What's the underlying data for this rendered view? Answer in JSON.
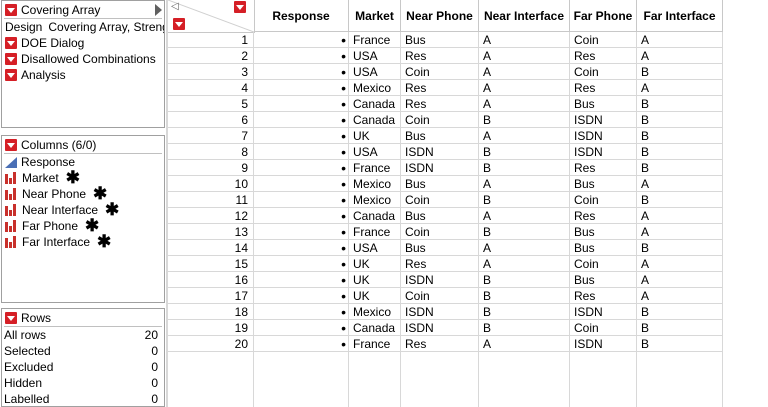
{
  "table_panel": {
    "title": "Covering Array",
    "design_label": "Design",
    "design_value": "Covering Array, Streng",
    "scripts": [
      "DOE Dialog",
      "Disallowed Combinations",
      "Analysis"
    ]
  },
  "columns_panel": {
    "title": "Columns (6/0)",
    "items": [
      {
        "name": "Response",
        "type": "continuous",
        "locked": false
      },
      {
        "name": "Market",
        "type": "nominal",
        "locked": true
      },
      {
        "name": "Near Phone",
        "type": "nominal",
        "locked": true
      },
      {
        "name": "Near Interface",
        "type": "nominal",
        "locked": true
      },
      {
        "name": "Far Phone",
        "type": "nominal",
        "locked": true
      },
      {
        "name": "Far Interface",
        "type": "nominal",
        "locked": true
      }
    ],
    "lock_symbol": "✱"
  },
  "rows_panel": {
    "title": "Rows",
    "stats": [
      {
        "label": "All rows",
        "value": "20"
      },
      {
        "label": "Selected",
        "value": "0"
      },
      {
        "label": "Excluded",
        "value": "0"
      },
      {
        "label": "Hidden",
        "value": "0"
      },
      {
        "label": "Labelled",
        "value": "0"
      }
    ]
  },
  "grid": {
    "columns": [
      "Response",
      "Market",
      "Near Phone",
      "Near Interface",
      "Far Phone",
      "Far Interface"
    ],
    "missing_symbol": "•",
    "rows": [
      {
        "n": "1",
        "market": "France",
        "near_phone": "Bus",
        "near_interface": "A",
        "far_phone": "Coin",
        "far_interface": "A"
      },
      {
        "n": "2",
        "market": "USA",
        "near_phone": "Res",
        "near_interface": "A",
        "far_phone": "Res",
        "far_interface": "A"
      },
      {
        "n": "3",
        "market": "USA",
        "near_phone": "Coin",
        "near_interface": "A",
        "far_phone": "Coin",
        "far_interface": "B"
      },
      {
        "n": "4",
        "market": "Mexico",
        "near_phone": "Res",
        "near_interface": "A",
        "far_phone": "Res",
        "far_interface": "A"
      },
      {
        "n": "5",
        "market": "Canada",
        "near_phone": "Res",
        "near_interface": "A",
        "far_phone": "Bus",
        "far_interface": "B"
      },
      {
        "n": "6",
        "market": "Canada",
        "near_phone": "Coin",
        "near_interface": "B",
        "far_phone": "ISDN",
        "far_interface": "B"
      },
      {
        "n": "7",
        "market": "UK",
        "near_phone": "Bus",
        "near_interface": "A",
        "far_phone": "ISDN",
        "far_interface": "B"
      },
      {
        "n": "8",
        "market": "USA",
        "near_phone": "ISDN",
        "near_interface": "B",
        "far_phone": "ISDN",
        "far_interface": "B"
      },
      {
        "n": "9",
        "market": "France",
        "near_phone": "ISDN",
        "near_interface": "B",
        "far_phone": "Res",
        "far_interface": "B"
      },
      {
        "n": "10",
        "market": "Mexico",
        "near_phone": "Bus",
        "near_interface": "A",
        "far_phone": "Bus",
        "far_interface": "A"
      },
      {
        "n": "11",
        "market": "Mexico",
        "near_phone": "Coin",
        "near_interface": "B",
        "far_phone": "Coin",
        "far_interface": "B"
      },
      {
        "n": "12",
        "market": "Canada",
        "near_phone": "Bus",
        "near_interface": "A",
        "far_phone": "Res",
        "far_interface": "A"
      },
      {
        "n": "13",
        "market": "France",
        "near_phone": "Coin",
        "near_interface": "B",
        "far_phone": "Bus",
        "far_interface": "A"
      },
      {
        "n": "14",
        "market": "USA",
        "near_phone": "Bus",
        "near_interface": "A",
        "far_phone": "Bus",
        "far_interface": "B"
      },
      {
        "n": "15",
        "market": "UK",
        "near_phone": "Res",
        "near_interface": "A",
        "far_phone": "Coin",
        "far_interface": "A"
      },
      {
        "n": "16",
        "market": "UK",
        "near_phone": "ISDN",
        "near_interface": "B",
        "far_phone": "Bus",
        "far_interface": "A"
      },
      {
        "n": "17",
        "market": "UK",
        "near_phone": "Coin",
        "near_interface": "B",
        "far_phone": "Res",
        "far_interface": "A"
      },
      {
        "n": "18",
        "market": "Mexico",
        "near_phone": "ISDN",
        "near_interface": "B",
        "far_phone": "ISDN",
        "far_interface": "B"
      },
      {
        "n": "19",
        "market": "Canada",
        "near_phone": "ISDN",
        "near_interface": "B",
        "far_phone": "Coin",
        "far_interface": "B"
      },
      {
        "n": "20",
        "market": "France",
        "near_phone": "Res",
        "near_interface": "A",
        "far_phone": "ISDN",
        "far_interface": "B"
      }
    ]
  },
  "colors": {
    "red_menu": "#d51f26",
    "continuous_icon": "#4a6fb5",
    "nominal_icon": "#c8302b",
    "grid_line": "#d8d8d8"
  }
}
